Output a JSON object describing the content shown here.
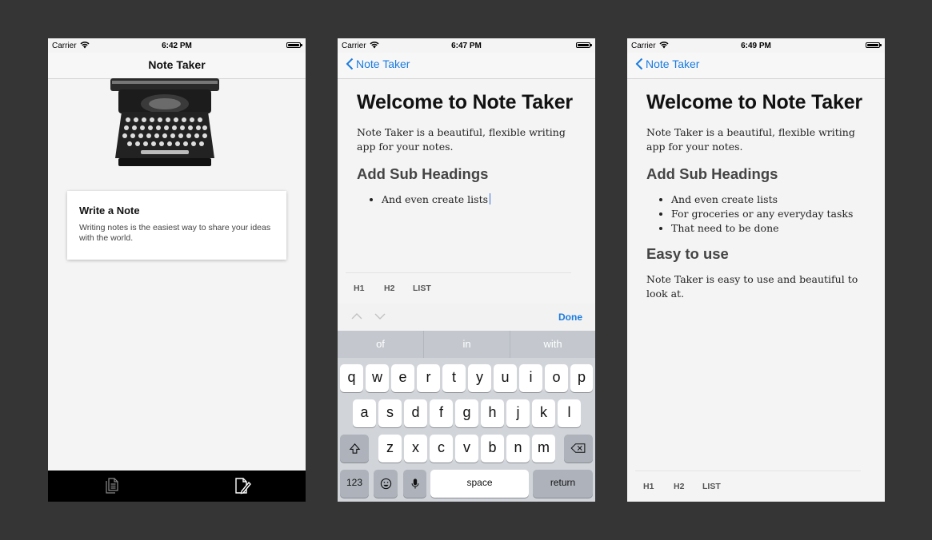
{
  "status": {
    "carrier": "Carrier",
    "times": [
      "6:42 PM",
      "6:47 PM",
      "6:49 PM"
    ]
  },
  "home": {
    "nav_title": "Note Taker",
    "card_title": "Write a Note",
    "card_text": "Writing notes is the easiest way to share your ideas with the world.",
    "tabs": [
      {
        "icon": "notes-list-icon"
      },
      {
        "icon": "compose-icon"
      }
    ]
  },
  "editor": {
    "back_label": "Note Taker",
    "heading": "Welcome to Note Taker",
    "intro": "Note Taker is  a beautiful, flexible writing app for your notes.",
    "subheading": "Add Sub Headings",
    "list_item_1": "And even create lists",
    "format_buttons": [
      "H1",
      "H2",
      "LIST"
    ],
    "done_label": "Done"
  },
  "keyboard": {
    "predictions": [
      "of",
      "in",
      "with"
    ],
    "row1": [
      "q",
      "w",
      "e",
      "r",
      "t",
      "y",
      "u",
      "i",
      "o",
      "p"
    ],
    "row2": [
      "a",
      "s",
      "d",
      "f",
      "g",
      "h",
      "j",
      "k",
      "l"
    ],
    "row3": [
      "z",
      "x",
      "c",
      "v",
      "b",
      "n",
      "m"
    ],
    "numbers_label": "123",
    "space_label": "space",
    "return_label": "return"
  },
  "preview": {
    "back_label": "Note Taker",
    "heading": "Welcome to Note Taker",
    "intro": "Note Taker is  a beautiful, flexible writing app for your notes.",
    "subheading": "Add Sub Headings",
    "list": [
      "And even create lists",
      "For groceries or any everyday tasks",
      "That need to be done"
    ],
    "subheading2": "Easy to use",
    "paragraph2": "Note Taker is easy to use and beautiful to look at.",
    "format_buttons": [
      "H1",
      "H2",
      "LIST"
    ]
  },
  "colors": {
    "accent": "#1a7be0",
    "background": "#353535",
    "tabbar": "#000000"
  }
}
